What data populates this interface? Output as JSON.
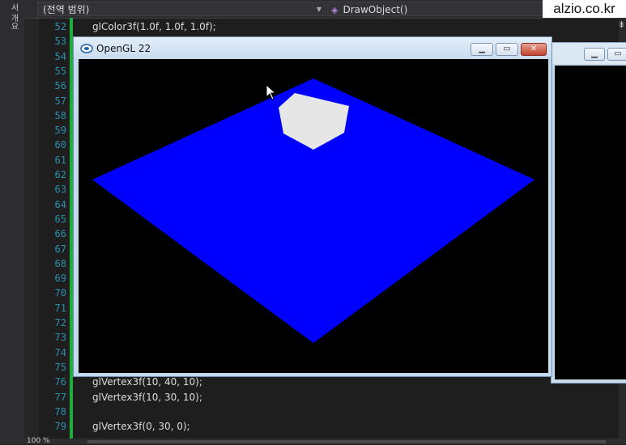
{
  "editor": {
    "scope_dropdown": "(전역 범위)",
    "member_dropdown": "DrawObject()",
    "left_strip_text": "서 개요",
    "zoom_level": "100 %",
    "line_numbers": [
      "52",
      "53",
      "54",
      "55",
      "56",
      "57",
      "58",
      "59",
      "60",
      "61",
      "62",
      "63",
      "64",
      "65",
      "66",
      "67",
      "68",
      "69",
      "70",
      "71",
      "72",
      "73",
      "74",
      "75",
      "76",
      "77",
      "78",
      "79"
    ],
    "code_lines": [
      {
        "line": "52",
        "text": "glColor3f(1.0f, 1.0f, 1.0f);"
      },
      {
        "line": "76",
        "text": "glVertex3f(10, 40, 10);"
      },
      {
        "line": "77",
        "text": "glVertex3f(10, 30, 10);"
      },
      {
        "line": "79",
        "text": "glVertex3f(0, 30, 0);"
      }
    ]
  },
  "watermark": "alzio.co.kr",
  "opengl_window": {
    "title": "OpenGL 22",
    "buttons": {
      "minimize": "minimize-icon",
      "maximize": "maximize-icon",
      "close": "close-icon"
    },
    "scene": {
      "background_color": "#000000",
      "plane_color": "#0000ff",
      "hexagon_color": "#e6e6e6"
    }
  },
  "colors": {
    "editor_bg": "#1e1e1e",
    "line_number": "#2b91af",
    "change_bar": "#1fae3d",
    "window_frame": "#c3d9ee",
    "close_button": "#c3432d"
  }
}
